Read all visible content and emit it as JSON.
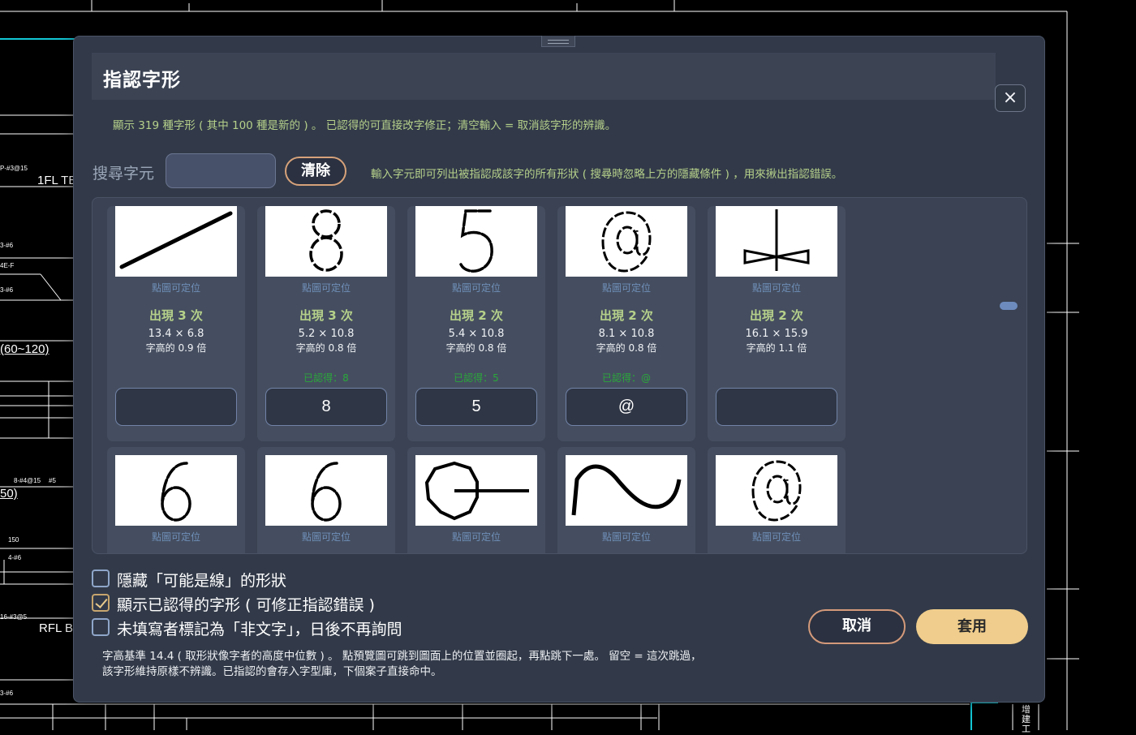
{
  "background": {
    "labels": [
      "1FL TE",
      "(60~120)",
      "50)",
      "RFL B",
      "150",
      "增",
      "建",
      "工"
    ],
    "small_labels": [
      "P-#3@15",
      "3-#6",
      "4E-F",
      "3-#6",
      "8-#4@15",
      "#5",
      "4-#6",
      "16-#3@5",
      "3-#6"
    ]
  },
  "dialog": {
    "title": "指認字形",
    "close_icon": "×",
    "summary": "顯示 319 種字形 ( 其中 100 種是新的 ) 。  已認得的可直接改字修正；清空輸入 = 取消該字形的辨識。",
    "search": {
      "label": "搜尋字元",
      "value": "",
      "placeholder": "",
      "clear_label": "清除",
      "hint": "輸入字元即可列出被指認成該字的所有形狀 ( 搜尋時忽略上方的隱藏條件 ) ，用來揪出指認錯誤。"
    },
    "cards": [
      {
        "glyph": "line",
        "locate": "點圖可定位",
        "count": "出現 3 次",
        "size": "13.4 × 6.8",
        "ratio": "字高的 0.9 倍",
        "recognized": "",
        "value": ""
      },
      {
        "glyph": "eight",
        "locate": "點圖可定位",
        "count": "出現 3 次",
        "size": "5.2 × 10.8",
        "ratio": "字高的 0.8 倍",
        "recognized": "已認得：8",
        "value": "8"
      },
      {
        "glyph": "five",
        "locate": "點圖可定位",
        "count": "出現 2 次",
        "size": "5.4 × 10.8",
        "ratio": "字高的 0.8 倍",
        "recognized": "已認得：5",
        "value": "5"
      },
      {
        "glyph": "at",
        "locate": "點圖可定位",
        "count": "出現 2 次",
        "size": "8.1 × 10.8",
        "ratio": "字高的 0.8 倍",
        "recognized": "已認得：@",
        "value": "@"
      },
      {
        "glyph": "symbol",
        "locate": "點圖可定位",
        "count": "出現 2 次",
        "size": "16.1 × 15.9",
        "ratio": "字高的 1.1 倍",
        "recognized": "",
        "value": ""
      },
      {
        "glyph": "six",
        "locate": "點圖可定位"
      },
      {
        "glyph": "six",
        "locate": "點圖可定位"
      },
      {
        "glyph": "circle-line",
        "locate": "點圖可定位"
      },
      {
        "glyph": "wave",
        "locate": "點圖可定位"
      },
      {
        "glyph": "at",
        "locate": "點圖可定位"
      }
    ],
    "options": [
      {
        "label": "隱藏「可能是線」的形狀",
        "checked": false
      },
      {
        "label": "顯示已認得的字形 ( 可修正指認錯誤 )",
        "checked": true
      },
      {
        "label": "未填寫者標記為「非文字」，日後不再詢問",
        "checked": false
      }
    ],
    "cancel_label": "取消",
    "apply_label": "套用",
    "footer": [
      "字高基準 14.4 ( 取形狀像字者的高度中位數 ) 。  點預覽圖可跳到圖面上的位置並圈起，再點跳下一處。  留空 = 這次跳過，",
      "該字形維持原樣不辨識。已指認的會存入字型庫，下個案子直接命中。"
    ]
  }
}
